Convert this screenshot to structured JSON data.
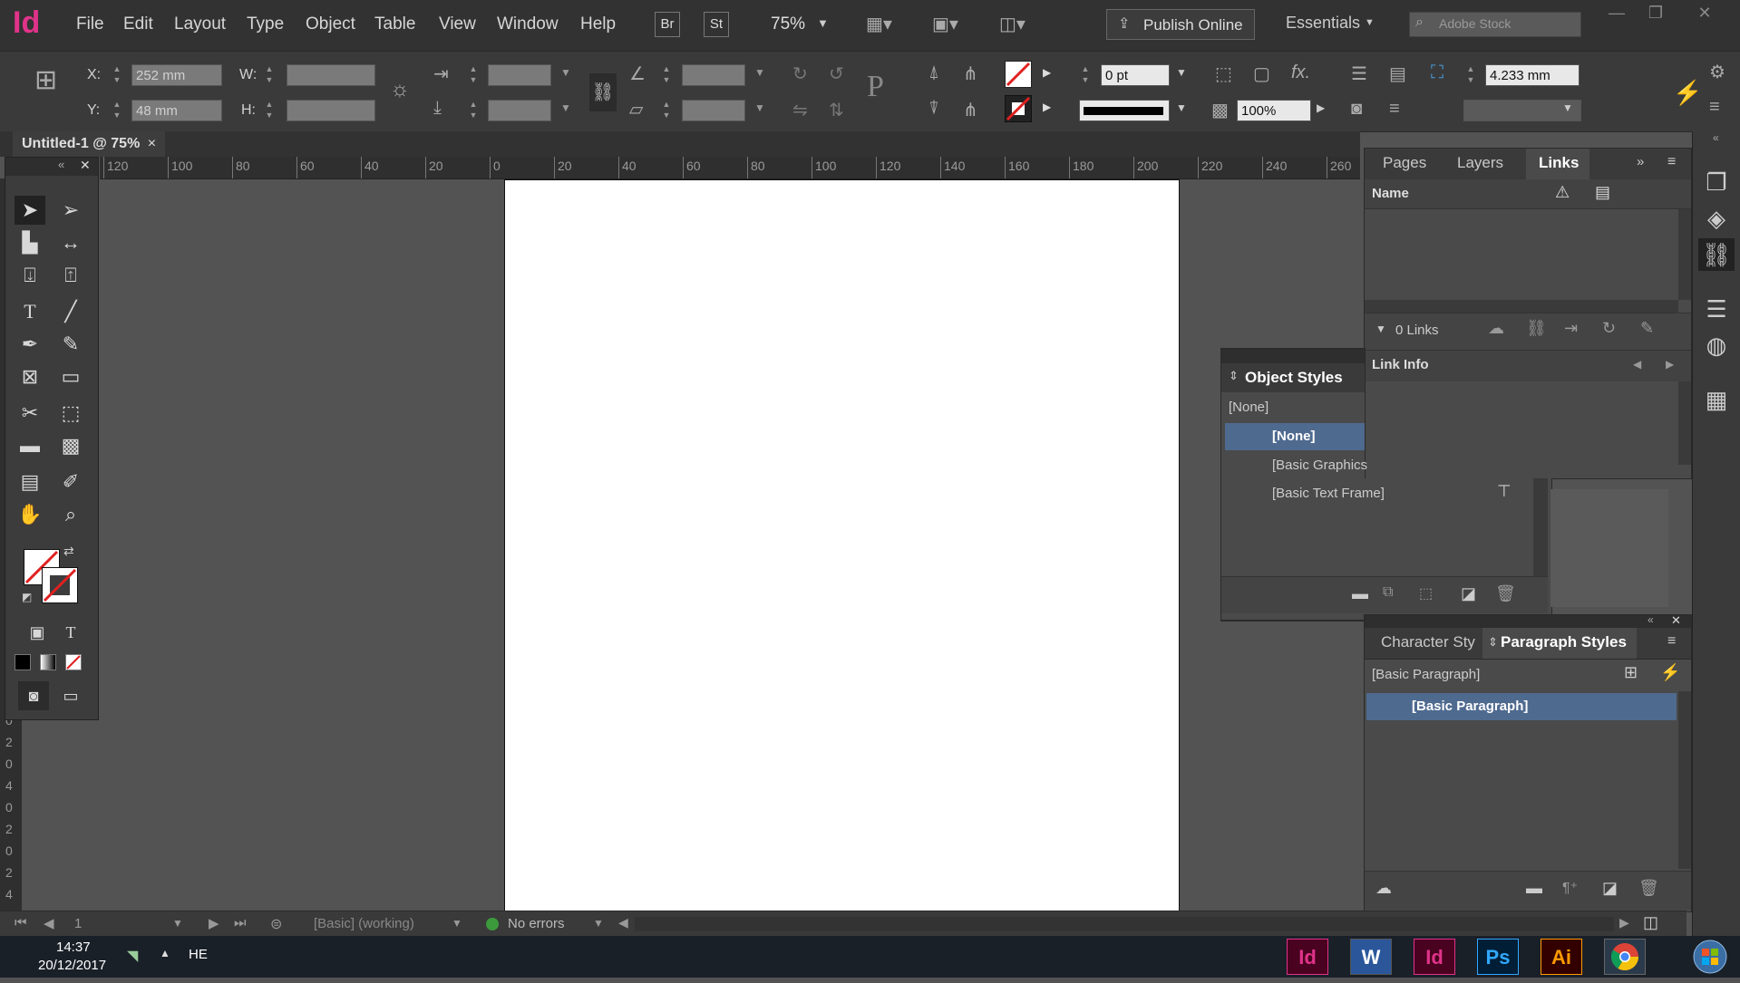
{
  "app": {
    "logo": "Id"
  },
  "menu": [
    "File",
    "Edit",
    "Layout",
    "Type",
    "Object",
    "Table",
    "View",
    "Window",
    "Help"
  ],
  "menubar": {
    "bridge": "Br",
    "stock": "St",
    "zoom": "75%",
    "publish_online": "Publish Online",
    "workspace": "Essentials",
    "search_placeholder": "Adobe Stock"
  },
  "control": {
    "x_label": "X:",
    "x_value": "252 mm",
    "y_label": "Y:",
    "y_value": "48 mm",
    "w_label": "W:",
    "h_label": "H:",
    "stroke_weight": "0 pt",
    "opacity": "100%",
    "size_value": "4.233 mm"
  },
  "document": {
    "tab_title": "Untitled-1 @ 75%"
  },
  "ruler": {
    "ticks": [
      "120",
      "100",
      "80",
      "60",
      "40",
      "20",
      "0",
      "20",
      "40",
      "60",
      "80",
      "100",
      "120",
      "140",
      "160",
      "180",
      "200",
      "220",
      "240",
      "260"
    ],
    "vertical": [
      "0",
      "2",
      "0",
      "4",
      "0",
      "2",
      "0",
      "2",
      "4",
      "0"
    ]
  },
  "links_panel": {
    "tabs": [
      "Pages",
      "Layers",
      "Links"
    ],
    "active": "Links",
    "column_name": "Name",
    "count": "0 Links",
    "link_info": "Link Info"
  },
  "object_styles": {
    "title": "Object Styles",
    "current": "[None]",
    "items": [
      "[None]",
      "[Basic Graphics",
      "[Basic Text Frame]"
    ],
    "selected_index": 0
  },
  "paragraph_panel": {
    "tabs": [
      "Character Sty",
      "Paragraph Styles"
    ],
    "active": "Paragraph Styles",
    "current": "[Basic Paragraph]",
    "items": [
      "[Basic Paragraph]"
    ]
  },
  "status": {
    "page": "1",
    "profile": "[Basic] (working)",
    "errors": "No errors",
    "ok_color": "#3c9a3c"
  },
  "taskbar": {
    "time": "14:37",
    "date": "20/12/2017",
    "lang": "HE",
    "apps": [
      {
        "label": "Id",
        "color": "#e0338a",
        "bg": "#49021f"
      },
      {
        "label": "W",
        "color": "#ffffff",
        "bg": "#2b579a"
      },
      {
        "label": "Id",
        "color": "#e0338a",
        "bg": "#49021f"
      },
      {
        "label": "Ps",
        "color": "#31a8ff",
        "bg": "#001e36"
      },
      {
        "label": "Ai",
        "color": "#ff9a00",
        "bg": "#330000"
      }
    ]
  }
}
